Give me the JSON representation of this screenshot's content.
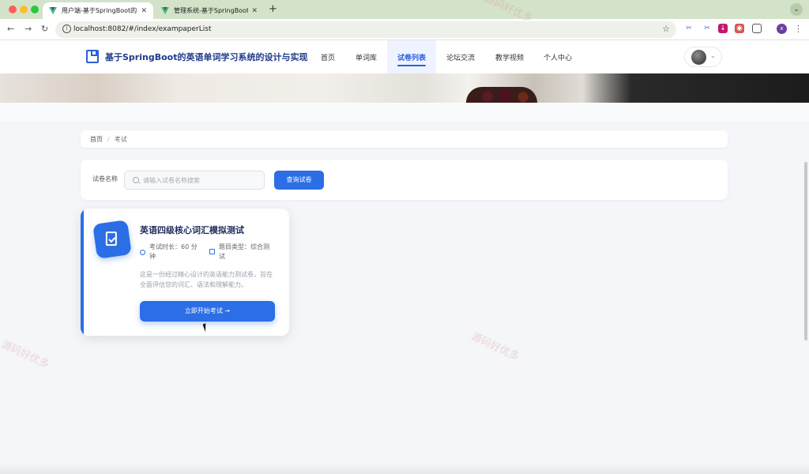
{
  "browser": {
    "tabs": [
      {
        "title": "用户端-基于SpringBoot的英语"
      },
      {
        "title": "管理系统-基于SpringBoot的英"
      }
    ],
    "new_tab": "+",
    "url": "localhost:8082/#/index/exampaperList",
    "profile_initial": "x"
  },
  "header": {
    "site_title": "基于SpringBoot的英语单词学习系统的设计与实现",
    "nav": [
      {
        "label": "首页"
      },
      {
        "label": "单词库"
      },
      {
        "label": "试卷列表"
      },
      {
        "label": "论坛交流"
      },
      {
        "label": "教学视频"
      },
      {
        "label": "个人中心"
      }
    ],
    "active_nav": "试卷列表"
  },
  "banner": {
    "slides": 3,
    "active_slide": 1
  },
  "breadcrumb": {
    "home": "首页",
    "separator": "/",
    "current": "考试"
  },
  "search": {
    "label": "试卷名称",
    "placeholder": "请输入试卷名称搜索",
    "value": "",
    "button": "查询试卷"
  },
  "exams": [
    {
      "title": "英语四级核心词汇模拟测试",
      "duration": "考试时长：60 分钟",
      "type": "题目类型：综合测试",
      "description": "这是一份经过精心设计的英语能力测试卷，旨在全面评估您的词汇、语法和理解能力。",
      "button": "立即开始考试 →"
    }
  ],
  "watermark": "源码好优多",
  "colors": {
    "primary": "#2b6ee6",
    "brand_title": "#1f3a8a",
    "tabbar": "#d3e3c9"
  }
}
